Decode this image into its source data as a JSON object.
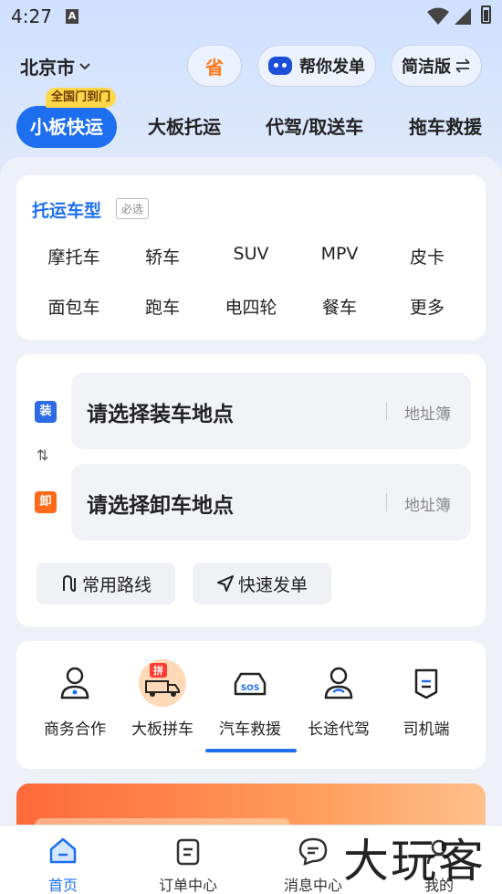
{
  "status": {
    "time": "4:27",
    "a_badge": "A"
  },
  "header": {
    "city": "北京市",
    "save_label": "省",
    "help_label": "帮你发单",
    "simple_label": "简洁版"
  },
  "tabs": [
    {
      "label": "小板快运",
      "active": true
    },
    {
      "label": "大板托运",
      "active": false
    },
    {
      "label": "代驾/取送车",
      "active": false
    },
    {
      "label": "拖车救援",
      "active": false
    }
  ],
  "tab_tag": "全国门到门",
  "vehicle": {
    "title": "托运车型",
    "required": "必选",
    "types": [
      "摩托车",
      "轿车",
      "SUV",
      "MPV",
      "皮卡",
      "面包车",
      "跑车",
      "电四轮",
      "餐车",
      "更多"
    ]
  },
  "address": {
    "load_badge": "装",
    "unload_badge": "卸",
    "load_placeholder": "请选择装车地点",
    "unload_placeholder": "请选择卸车地点",
    "book_label": "地址簿",
    "common_route": "常用路线",
    "quick_order": "快速发单"
  },
  "services": {
    "items": [
      {
        "label": "商务合作",
        "icon": "business-person-icon"
      },
      {
        "label": "大板拼车",
        "icon": "truck-carpool-icon",
        "tag": "拼"
      },
      {
        "label": "汽车救援",
        "icon": "car-sos-icon"
      },
      {
        "label": "长途代驾",
        "icon": "driver-person-icon"
      },
      {
        "label": "司机端",
        "icon": "driver-app-icon"
      }
    ]
  },
  "bottom_nav": [
    {
      "label": "首页",
      "icon": "home-icon",
      "active": true
    },
    {
      "label": "订单中心",
      "icon": "order-list-icon",
      "active": false
    },
    {
      "label": "消息中心",
      "icon": "message-icon",
      "active": false
    },
    {
      "label": "我的",
      "icon": "profile-icon",
      "active": false
    }
  ],
  "watermark": "大玩客",
  "colors": {
    "accent": "#1e6ff0",
    "orange": "#ff6a1a",
    "tag_yellow": "#ffd84a"
  }
}
